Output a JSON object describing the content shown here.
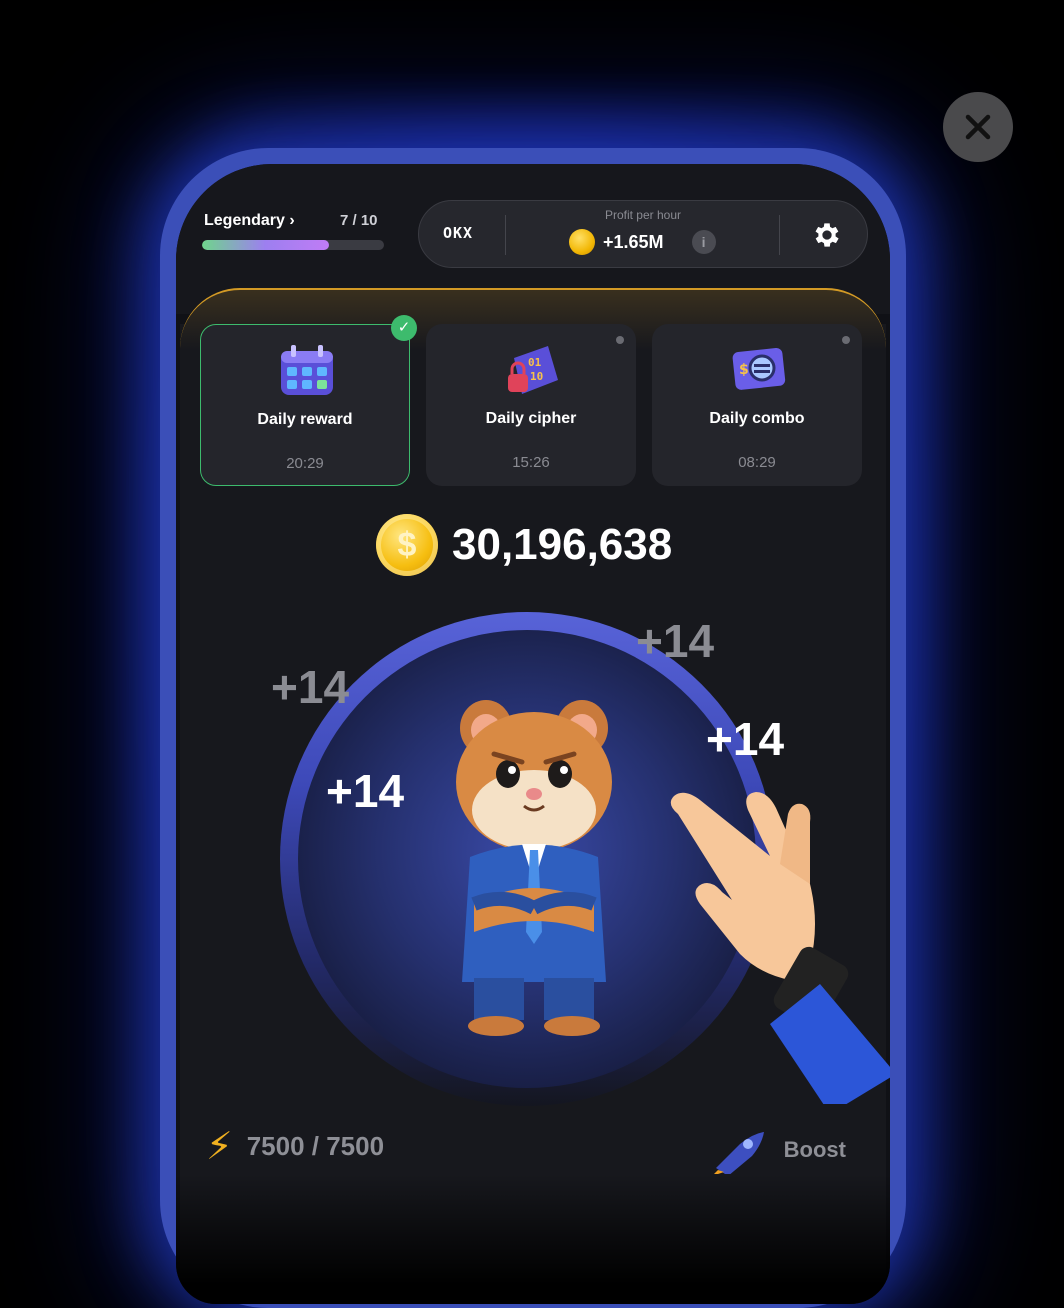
{
  "header": {
    "rank": "Legendary",
    "rank_count": "7 / 10",
    "rank_progress": 0.7,
    "exchange": "OKX",
    "profit_label": "Profit per hour",
    "profit_value": "+1.65M"
  },
  "daily": [
    {
      "title": "Daily reward",
      "time": "20:29",
      "completed": true
    },
    {
      "title": "Daily cipher",
      "time": "15:26",
      "completed": false
    },
    {
      "title": "Daily combo",
      "time": "08:29",
      "completed": false
    }
  ],
  "balance": "30,196,638",
  "tap_popups": [
    "+14",
    "+14",
    "+14",
    "+14"
  ],
  "energy": "7500 / 7500",
  "boost_label": "Boost",
  "colors": {
    "accent": "#3b4fb8",
    "gold": "#f6be10",
    "success": "#3dbb6d"
  },
  "icons": [
    "chevron-right-icon",
    "info-icon",
    "gear-icon",
    "check-icon",
    "coin-icon",
    "lightning-icon",
    "rocket-icon",
    "close-icon"
  ]
}
